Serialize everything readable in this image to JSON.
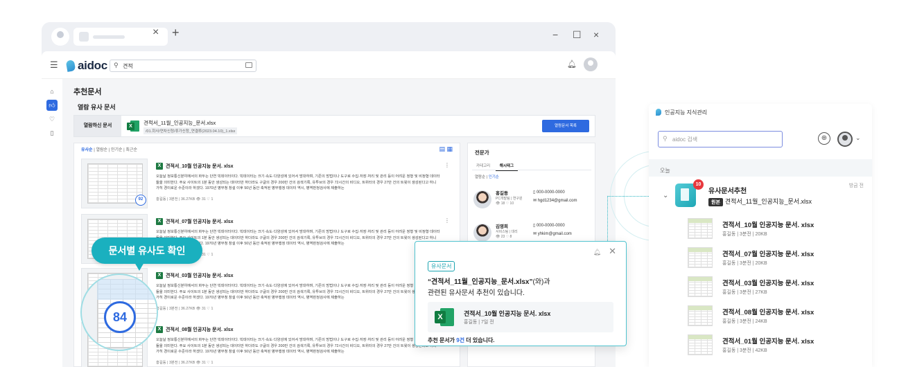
{
  "browser": {
    "tab_close": "×",
    "tab_new": "+",
    "minimize": "−",
    "maximize": "☐",
    "close": "×"
  },
  "app": {
    "logo": "aidoc",
    "search_value": "견적",
    "section_title": "추천문서",
    "subsection_title": "열람 유사 문서",
    "viewed": {
      "label": "열람하신 문서",
      "file_name": "견적서_11월_인공지능_문서.xlsx",
      "file_path": "/01.회사/연차신청/휴가신청_연결류(2023.04.10)_1.xlsx",
      "button": "열람문서 목록"
    },
    "sort": [
      "유사순",
      "열람순",
      "인기순",
      "최근순"
    ],
    "docs": [
      {
        "title": "견적서_10월 인공지능 문서. xlsx",
        "desc": "오늘날 정보통신분야에서의 화두는 단연 빅데이터이다. 빅데이터는 크기·속도·다양성에 있어서 방대하며, 기존의 방법이나 도구로 수집·저장·처리 및 관리 등이 어려운 정형 및 비정형 데이터들을 의미한다. 주요 사이트의 1분 동안 생성되는 데이터만 하더라도 구글의 경우 200만 건의 검색기록, 유투브의 경우 72시간의 비디오, 트위터의 경우 27만 건의 트윗이 생성된다고 하니 가히 경이로운 수준이라 하겠다. 1970년 병무청 창설 이후 50년 동안 축적된 병무행정 데이터 역시, 병역판정검사에 제출하는",
        "meta": "홍길동 | 3분전 | 36.27KB   👁 31  ♡ 1",
        "score": "92"
      },
      {
        "title": "견적서_07월 인공지능 문서. xlsx",
        "desc": "오늘날 정보통신분야에서의 화두는 단연 빅데이터이다. 빅데이터는 크기·속도·다양성에 있어서 방대하며, 기존의 방법이나 도구로 수집·저장·처리 및 관리 등이 어려운 정형 및 비정형 데이터들을 의미한다. 주요 사이트의 1분 동안 생성되는 데이터만 하더라도 구글의 경우 200만 건의 검색기록, 유투브의 경우 72시간의 비디오, 트위터의 경우 27만 건의 트윗이 생성된다고 하니 가히 경이로운 수준이라 하겠다. 1970년 병무청 창설 이후 50년 동안 축적된 병무행정 데이터 역시, 병역판정검사에 제출하는",
        "meta": "홍길동 | 3분전 | 36.27KB   👁 31  ♡ 1"
      },
      {
        "title": "견적서_03월 인공지능 문서. xlsx",
        "desc": "오늘날 정보통신분야에서의 화두는 단연 빅데이터이다. 빅데이터는 크기·속도·다양성에 있어서 방대하며, 기존의 방법이나 도구로 수집·저장·처리 및 관리 등이 어려운 정형 및 비정형 데이터들을 의미한다. 주요 사이트의 1분 동안 생성되는 데이터만 하더라도 구글의 경우 200만 건의 검색기록, 유투브의 경우 72시간의 비디오, 트위터의 경우 27만 건의 트윗이 생성된다고 하니 가히 경이로운 수준이라 하겠다. 1970년 병무청 창설 이후 50년 동안 축적된 병무행정 데이터 역시, 병역판정검사에 제출하는",
        "meta": "홍길동 | 3분전 | 36.27KB   👁 31  ♡ 1"
      },
      {
        "title": "견적서_08월 인공지능 문서. xlsx",
        "desc": "오늘날 정보통신분야에서의 화두는 단연 빅데이터이다. 빅데이터는 크기·속도·다양성에 있어서 방대하며, 기존의 방법이나 도구로 수집·저장·처리 및 관리 등이 어려운 정형 및 비정형 데이터들을 의미한다. 주요 사이트의 1분 동안 생성되는 데이터만 하더라도 구글의 경우 200만 건의 검색기록, 유투브의 경우 72시간의 비디오, 트위터의 경우 27만 건의 트윗이 생성된다고 하니 가히 경이로운 수준이라 하겠다. 1970년 병무청 창설 이후 50년 동안 축적된 병무행정 데이터 역시, 병역판정검사에 제출하는",
        "meta": "홍길동 | 3분전 | 36.27KB   👁 31  ♡ 1"
      }
    ],
    "experts": {
      "title": "전문가",
      "tab_category": "카테고리",
      "tab_hashtag": "해시태그",
      "sub_tabs": [
        "열람순",
        "인기순"
      ],
      "people": [
        {
          "name": "홍길동",
          "dept": "PC개발팀 | 연구원",
          "stats": "👁 18  ♡ 10",
          "phone": "000-0000-0000",
          "email": "hgd1234@gmail.com"
        },
        {
          "name": "김영희",
          "dept": "서비스팀 | 대리",
          "stats": "👁 23  ♡ 8",
          "phone": "000-0000-0000",
          "email": "yhkim@gmail.com"
        }
      ]
    }
  },
  "callout": {
    "label": "문서별 유사도 확인",
    "score": "84"
  },
  "toast": {
    "tag": "유사문서",
    "line1_bold": "“견적서_11월_인공지능_문서.xlsx”",
    "line1_rest": "(와)과",
    "line2": "관련된 유사문서 추천이 있습니다.",
    "card_title": "견적서_10월 인공지능 문서. xlsx",
    "card_sub": "홍길동 | 7일 전",
    "footer_pre": "추천 문서가 ",
    "footer_count": "9건",
    "footer_post": " 더 있습니다."
  },
  "panel": {
    "title": "인공지능 지식관리",
    "search_placeholder": "aidoc 검색",
    "today": "오늘",
    "group_title": "유사문서추천",
    "group_time": "방금 전",
    "badge": "10",
    "origin_tag": "원본",
    "origin_file": "견적서_11월_인공지능_문서.xlsx",
    "items": [
      {
        "title": "견적서_10월 인공지능 문서. xlsx",
        "sub": "홍길동 | 3분전 | 20KB"
      },
      {
        "title": "견적서_07월 인공지능 문서. xlsx",
        "sub": "홍길동 | 3분전 | 20KB"
      },
      {
        "title": "견적서_03월 인공지능 문서. xlsx",
        "sub": "홍길동 | 3분전 | 27KB"
      },
      {
        "title": "견적서_08월 인공지능 문서. xlsx",
        "sub": "홍길동 | 3분전 | 24KB"
      },
      {
        "title": "견적서_01월 인공지능 문서. xlsx",
        "sub": "홍길동 | 3분전 | 42KB"
      }
    ]
  }
}
